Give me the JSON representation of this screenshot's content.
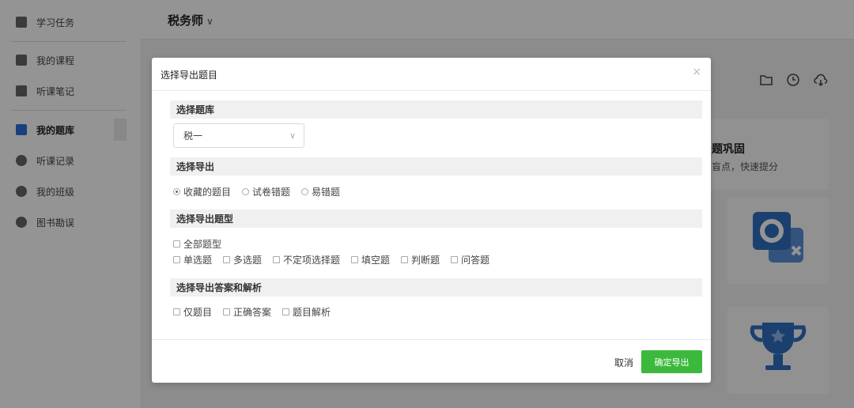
{
  "sidebar": {
    "items": [
      {
        "label": "学习任务",
        "icon": "task-list-icon"
      },
      {
        "label": "我的课程",
        "icon": "course-play-icon"
      },
      {
        "label": "听课笔记",
        "icon": "notes-icon"
      },
      {
        "label": "我的题库",
        "icon": "question-bank-icon"
      },
      {
        "label": "听课记录",
        "icon": "history-clock-icon"
      },
      {
        "label": "我的班级",
        "icon": "class-people-icon"
      },
      {
        "label": "图书勘误",
        "icon": "search-icon"
      }
    ]
  },
  "header": {
    "course": "税务师",
    "chevron": "∨"
  },
  "background": {
    "card_title": "题巩固",
    "card_sub": "盲点，快速提分"
  },
  "modal": {
    "title": "选择导出题目",
    "close": "×",
    "sections": {
      "bank": "选择题库",
      "export": "选择导出",
      "type": "选择导出题型",
      "answer": "选择导出答案和解析"
    },
    "bank_select": {
      "value": "税一",
      "arrow": "∨"
    },
    "export_options": [
      {
        "label": "收藏的题目",
        "checked": true
      },
      {
        "label": "试卷错题",
        "checked": false
      },
      {
        "label": "易错题",
        "checked": false
      }
    ],
    "type_all": "全部题型",
    "type_options": [
      "单选题",
      "多选题",
      "不定项选择题",
      "填空题",
      "判断题",
      "问答题"
    ],
    "answer_options": [
      "仅题目",
      "正确答案",
      "题目解析"
    ],
    "cancel": "取消",
    "confirm": "确定导出"
  },
  "colors": {
    "accent": "#3cb93c",
    "active": "#2b6fd6"
  }
}
